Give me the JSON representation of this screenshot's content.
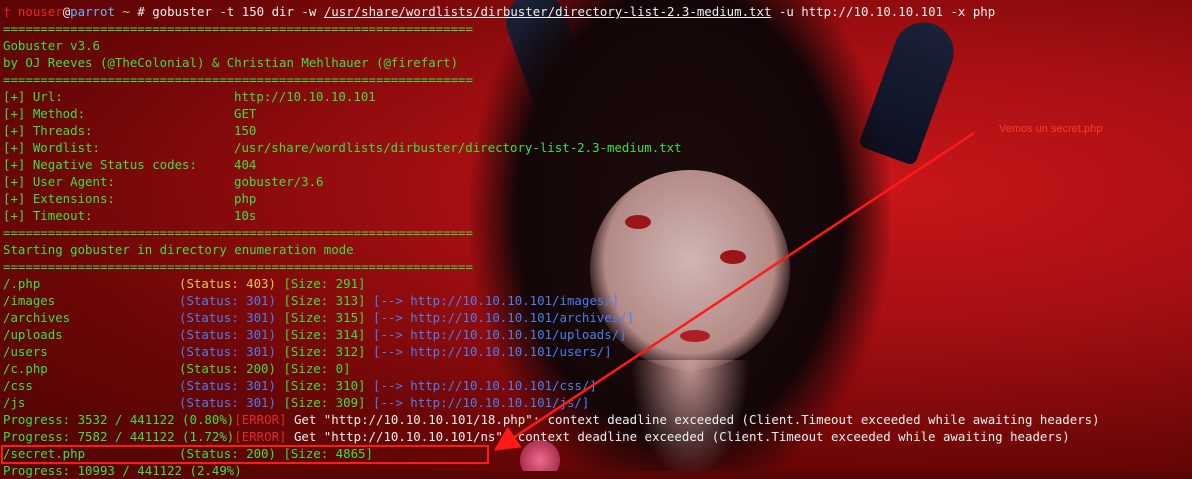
{
  "prompt": {
    "user": "nouser",
    "at": "@",
    "host": "parrot",
    "cwd": " ~ ",
    "symbol": "#",
    "cmd_pre": " gobuster -t 150 dir -w ",
    "wordlist": "/usr/share/wordlists/dirbuster/directory-list-2.3-medium.txt",
    "cmd_post": " -u http://10.10.10.101 -x php"
  },
  "banner": {
    "separator": "===============================================================",
    "title": "Gobuster v3.6",
    "authors": "by OJ Reeves (@TheColonial) & Christian Mehlhauer (@firefart)"
  },
  "config": [
    {
      "label": "[+] Url:",
      "value": "http://10.10.10.101"
    },
    {
      "label": "[+] Method:",
      "value": "GET"
    },
    {
      "label": "[+] Threads:",
      "value": "150"
    },
    {
      "label": "[+] Wordlist:",
      "value": "/usr/share/wordlists/dirbuster/directory-list-2.3-medium.txt"
    },
    {
      "label": "[+] Negative Status codes:",
      "value": "404"
    },
    {
      "label": "[+] User Agent:",
      "value": "gobuster/3.6"
    },
    {
      "label": "[+] Extensions:",
      "value": "php"
    },
    {
      "label": "[+] Timeout:",
      "value": "10s"
    }
  ],
  "start_msg": "Starting gobuster in directory enumeration mode",
  "results": [
    {
      "path": "/.php",
      "status": "(Status: 403)",
      "size": "[Size: 291]",
      "redirect": ""
    },
    {
      "path": "/images",
      "status": "(Status: 301)",
      "size": "[Size: 313]",
      "redirect": "[--> http://10.10.10.101/images/]"
    },
    {
      "path": "/archives",
      "status": "(Status: 301)",
      "size": "[Size: 315]",
      "redirect": "[--> http://10.10.10.101/archives/]"
    },
    {
      "path": "/uploads",
      "status": "(Status: 301)",
      "size": "[Size: 314]",
      "redirect": "[--> http://10.10.10.101/uploads/]"
    },
    {
      "path": "/users",
      "status": "(Status: 301)",
      "size": "[Size: 312]",
      "redirect": "[--> http://10.10.10.101/users/]"
    },
    {
      "path": "/c.php",
      "status": "(Status: 200)",
      "size": "[Size: 0]",
      "redirect": ""
    },
    {
      "path": "/css",
      "status": "(Status: 301)",
      "size": "[Size: 310]",
      "redirect": "[--> http://10.10.10.101/css/]"
    },
    {
      "path": "/js",
      "status": "(Status: 301)",
      "size": "[Size: 309]",
      "redirect": "[--> http://10.10.10.101/js/]"
    }
  ],
  "progress": [
    {
      "text": "Progress: 3532 / 441122 (0.80%)",
      "tag": "[ERROR]",
      "msg": " Get \"http://10.10.10.101/18.php\": context deadline exceeded (Client.Timeout exceeded while awaiting headers)"
    },
    {
      "text": "Progress: 7582 / 441122 (1.72%)",
      "tag": "[ERROR]",
      "msg": " Get \"http://10.10.10.101/ns\": context deadline exceeded (Client.Timeout exceeded while awaiting headers)"
    }
  ],
  "secret": {
    "path": "/secret.php",
    "status": "(Status: 200)",
    "size": "[Size: 4865]"
  },
  "last_progress": "Progress: 10993 / 441122 (2.49%)",
  "annotation": "Vemos un secret.php",
  "colors": {
    "annotation": "#ff1a1a",
    "terminal_text": "#3ce03c",
    "background": "#a40f12"
  }
}
